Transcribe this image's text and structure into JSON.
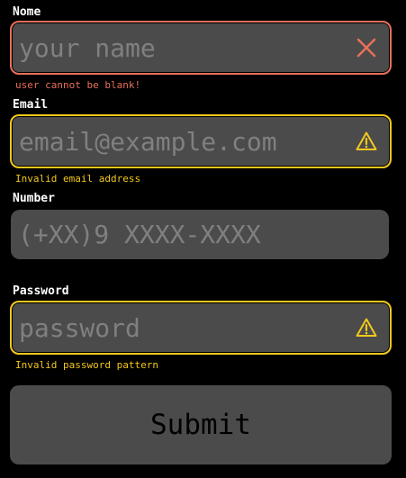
{
  "form": {
    "name": {
      "label": "Nome",
      "placeholder": "your name",
      "value": "",
      "status": "error",
      "message": "user cannot be blank!",
      "icon": "close-icon"
    },
    "email": {
      "label": "Email",
      "placeholder": "email@example.com",
      "value": "",
      "status": "warning",
      "message": "Invalid email address",
      "icon": "warning-icon"
    },
    "number": {
      "label": "Number",
      "placeholder": "(+XX)9 XXXX-XXXX",
      "value": ""
    },
    "password": {
      "label": "Password",
      "placeholder": "password",
      "value": "",
      "status": "warning",
      "message": "Invalid password pattern",
      "icon": "warning-icon"
    },
    "submit_label": "Submit"
  },
  "colors": {
    "background": "#000000",
    "field_bg": "#4b4b4b",
    "error": "#e86f5a",
    "warning": "#f3c81c",
    "placeholder": "#808080",
    "label": "#ffffff"
  }
}
